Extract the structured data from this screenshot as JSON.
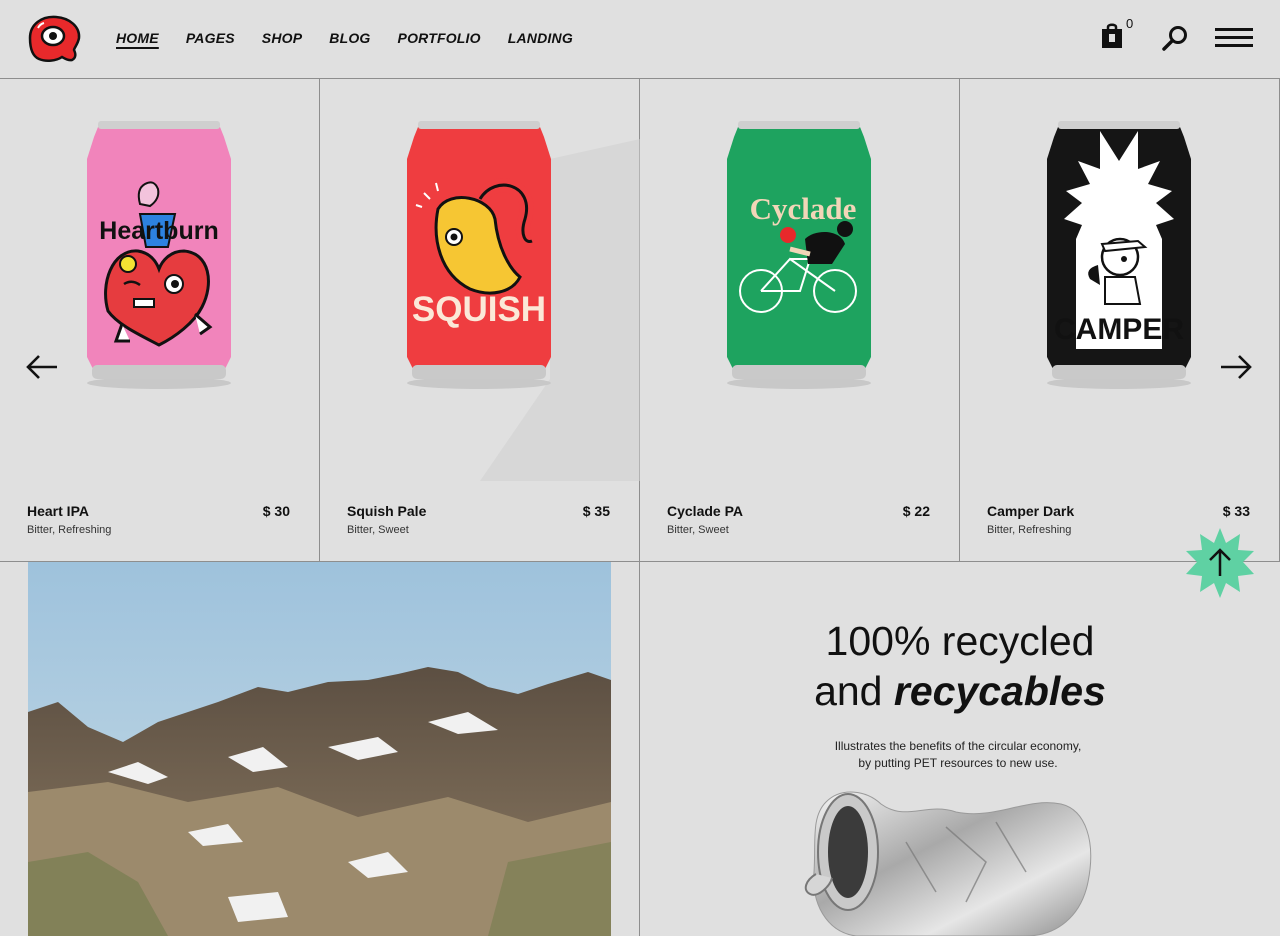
{
  "header": {
    "nav": [
      "HOME",
      "PAGES",
      "SHOP",
      "BLOG",
      "PORTFOLIO",
      "LANDING"
    ],
    "cart_count": "0"
  },
  "products": [
    {
      "name": "Heart IPA",
      "price": "$ 30",
      "tags": "Bitter, Refreshing",
      "can_color": "#ef80b8",
      "brand": "Heartburn"
    },
    {
      "name": "Squish Pale",
      "price": "$ 35",
      "tags": "Bitter, Sweet",
      "can_color": "#ee3b3b",
      "brand": "SQUISH"
    },
    {
      "name": "Cyclade PA",
      "price": "$ 22",
      "tags": "Bitter, Sweet",
      "can_color": "#1ea35f",
      "brand": "Cyclade"
    },
    {
      "name": "Camper Dark",
      "price": "$ 33",
      "tags": "Bitter, Refreshing",
      "can_color": "#151515",
      "brand": "CAMPER"
    }
  ],
  "feature": {
    "headline_line1": "100% recycled",
    "headline_line2_plain": "and ",
    "headline_line2_bold": "recycables",
    "sub_line1": "Illustrates the benefits of the circular economy,",
    "sub_line2": "by putting PET resources to new use."
  },
  "colors": {
    "background": "#e0e0e0",
    "accent_green": "#5fd1a3",
    "logo_red": "#e8292b"
  }
}
